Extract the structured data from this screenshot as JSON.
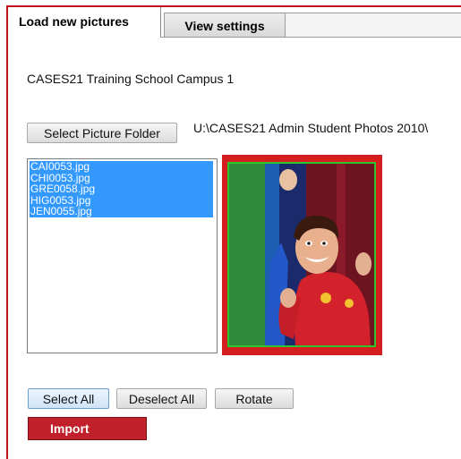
{
  "tabs": [
    {
      "label": "Load new pictures",
      "active": true
    },
    {
      "label": "View settings",
      "active": false
    }
  ],
  "school_name": "CASES21 Training School Campus 1",
  "folder": {
    "button_label": "Select Picture Folder",
    "path": "U:\\CASES21 Admin Student Photos 2010\\"
  },
  "files": [
    "CAI0053.jpg",
    "CHI0053.jpg",
    "GRE0058.jpg",
    "HIG0053.jpg",
    "JEN0055.jpg"
  ],
  "actions": {
    "select_all": "Select All",
    "deselect_all": "Deselect All",
    "rotate": "Rotate",
    "import": "Import"
  },
  "colors": {
    "accent_red": "#c0202a",
    "selection_blue": "#3399ff",
    "photo_border_green": "#2ec42e"
  }
}
